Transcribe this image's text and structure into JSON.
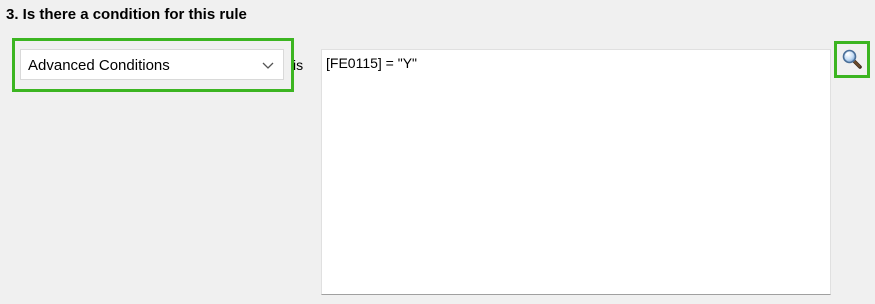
{
  "section": {
    "title": "3. Is there a condition for this rule"
  },
  "condition": {
    "type_selected": "Advanced Conditions",
    "connector_label": "is",
    "expression": "[FE0115] = \"Y\""
  },
  "icons": {
    "dropdown": "chevron-down-icon",
    "search": "magnifier-icon"
  },
  "colors": {
    "highlight": "#3cb521"
  }
}
